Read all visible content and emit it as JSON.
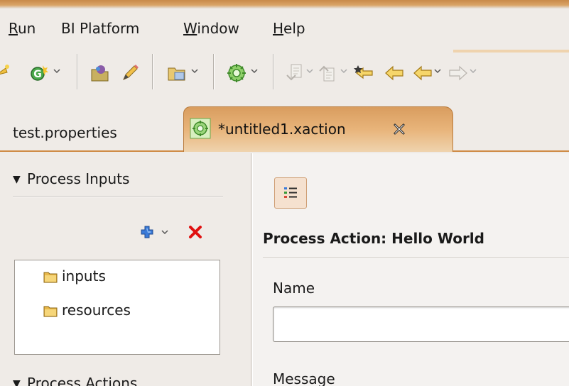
{
  "menu": {
    "run_label": "Run",
    "run_mnemonic": "R",
    "run_rest": "un",
    "bi_platform_label": "BI Platform",
    "window_mnemonic": "W",
    "window_rest": "indow",
    "help_mnemonic": "H",
    "help_rest": "elp"
  },
  "editor_tabs": [
    {
      "label": "test.properties",
      "active": false
    },
    {
      "label": "*untitled1.xaction",
      "active": true
    }
  ],
  "left_panel": {
    "process_inputs_label": "Process Inputs",
    "process_actions_label": "Process Actions",
    "tree_items": [
      "inputs",
      "resources"
    ]
  },
  "right_panel": {
    "title": "Process Action: Hello World",
    "name_label": "Name",
    "name_value": "",
    "message_label": "Message"
  },
  "colors": {
    "accent": "#cf8b45",
    "delete_red": "#e01010",
    "add_blue": "#2f6fd0",
    "folder": "#e8b84a"
  }
}
